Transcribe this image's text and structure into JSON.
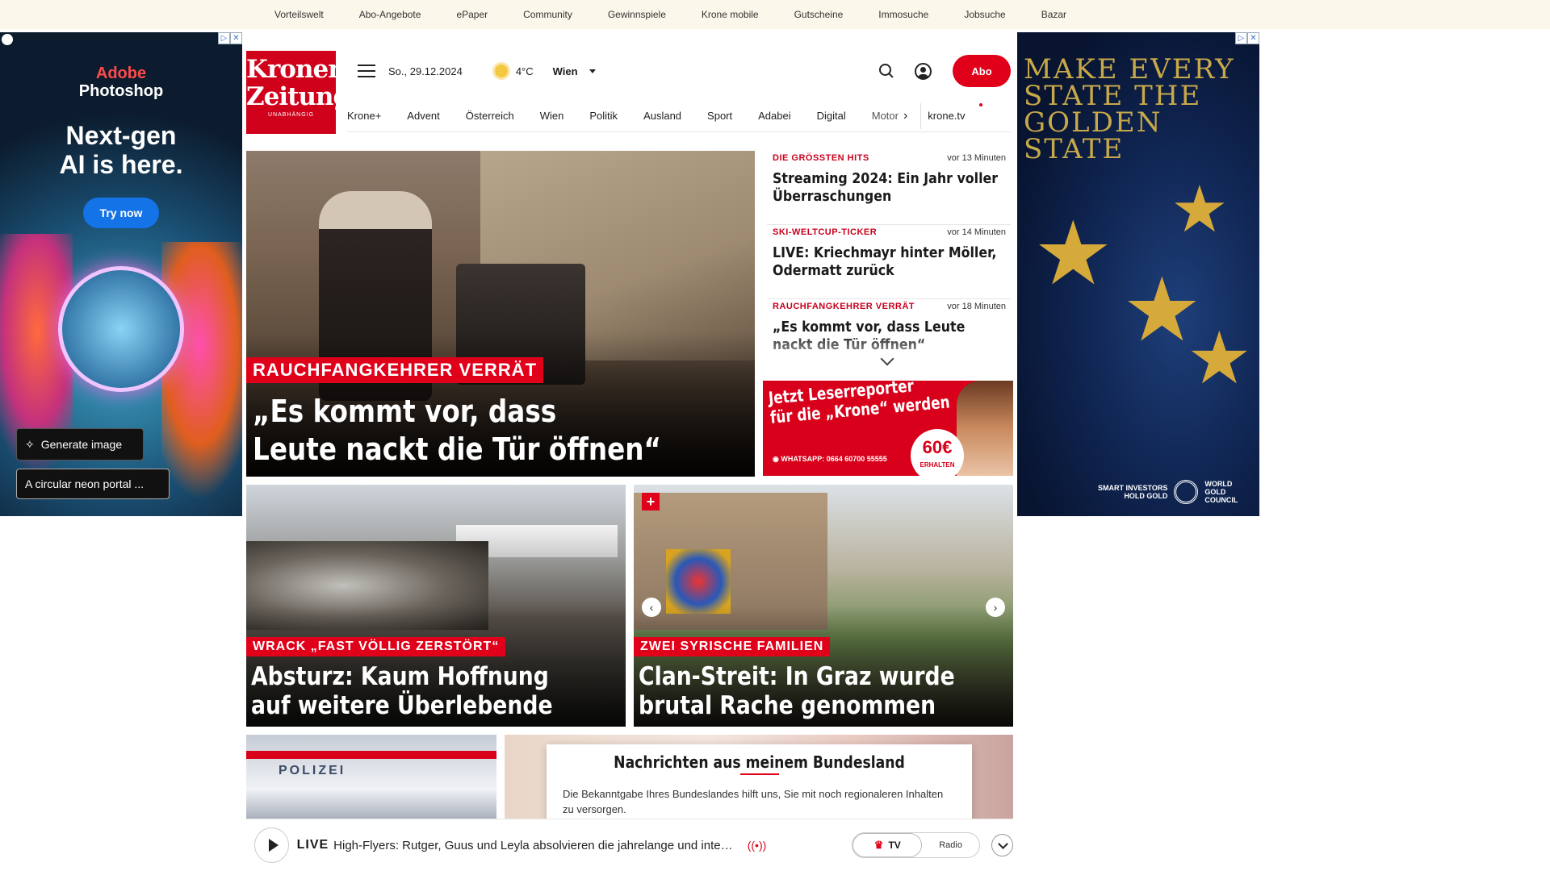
{
  "topbar": {
    "links": [
      "Vorteilswelt",
      "Abo-Angebote",
      "ePaper",
      "Community",
      "Gewinnspiele",
      "Krone mobile",
      "Gutscheine",
      "Immosuche",
      "Jobsuche",
      "Bazar"
    ]
  },
  "ad_left": {
    "brand_line1": "Adobe",
    "brand_line2": "Photoshop",
    "headline_line1": "Next-gen",
    "headline_line2": "AI is here.",
    "cta": "Try now",
    "generate_button": "Generate image",
    "prompt_value": "A circular neon portal ...",
    "adchoices": "▷",
    "close": "✕"
  },
  "ad_right": {
    "headline_line1": "MAKE EVERY",
    "headline_line2": "STATE THE",
    "headline_line3": "GOLDEN STATE",
    "footer_left_line1": "SMART INVESTORS",
    "footer_left_line2": "HOLD GOLD",
    "footer_right_line1": "WORLD",
    "footer_right_line2": "GOLD",
    "footer_right_line3": "COUNCIL",
    "adchoices": "▷",
    "close": "✕"
  },
  "header": {
    "logo_line1": "Kronen",
    "logo_line2": "Zeitung",
    "logo_tagline": "UNABHÄNGIG",
    "date": "So., 29.12.2024",
    "temperature": "4°C",
    "city": "Wien",
    "abo_label": "Abo"
  },
  "nav": {
    "items": [
      "Krone+",
      "Advent",
      "Österreich",
      "Wien",
      "Politik",
      "Ausland",
      "Sport",
      "Adabei",
      "Digital"
    ],
    "truncated": "Motor",
    "tv": "krone.tv"
  },
  "hero": {
    "kicker": "RAUCHFANGKEHRER VERRÄT",
    "title_line1": "„Es kommt vor, dass",
    "title_line2": "Leute nackt die Tür öffnen“"
  },
  "toplist": [
    {
      "category": "DIE GRÖSSTEN HITS",
      "time": "vor 13 Minuten",
      "headline": "Streaming 2024: Ein Jahr voller Überraschungen"
    },
    {
      "category": "SKI-WELTCUP-TICKER",
      "time": "vor 14 Minuten",
      "headline": "LIVE: Kriechmayr hinter Möller, Odermatt zurück"
    },
    {
      "category": "RAUCHFANGKEHRER VERRÄT",
      "time": "vor 18 Minuten",
      "headline": "„Es kommt vor, dass Leute nackt die Tür öffnen“"
    }
  ],
  "promo": {
    "line1": "Jetzt Leserreporter",
    "line2": "für die „Krone“ werden",
    "whatsapp": "WHATSAPP: 0664 60700 55555",
    "badge_amount": "60€",
    "badge_label": "ERHALTEN"
  },
  "cards": [
    {
      "kicker": "WRACK „FAST VÖLLIG ZERSTÖRT“",
      "title_line1": "Absturz: Kaum Hoffnung",
      "title_line2": "auf weitere Überlebende"
    },
    {
      "kicker": "ZWEI SYRISCHE FAMILIEN",
      "title_line1": "Clan-Streit: In Graz wurde",
      "title_line2": "brutal Rache genommen",
      "plus": "+"
    }
  ],
  "bottom": {
    "polizei": "POLIZEI"
  },
  "modal": {
    "title": "Nachrichten aus meinem Bundesland",
    "body": "Die Bekanntgabe Ihres Bundeslandes hilft uns, Sie mit noch regionaleren Inhalten zu versorgen."
  },
  "player": {
    "live_label": "LIVE",
    "now_playing": "High-Flyers: Rutger, Guus und Leyla absolvieren die jahrelange und inten…",
    "tv_label": "TV",
    "radio_label": "Radio"
  },
  "colors": {
    "brand_red": "#e1001a",
    "topbar_bg": "#fbf7ea"
  }
}
